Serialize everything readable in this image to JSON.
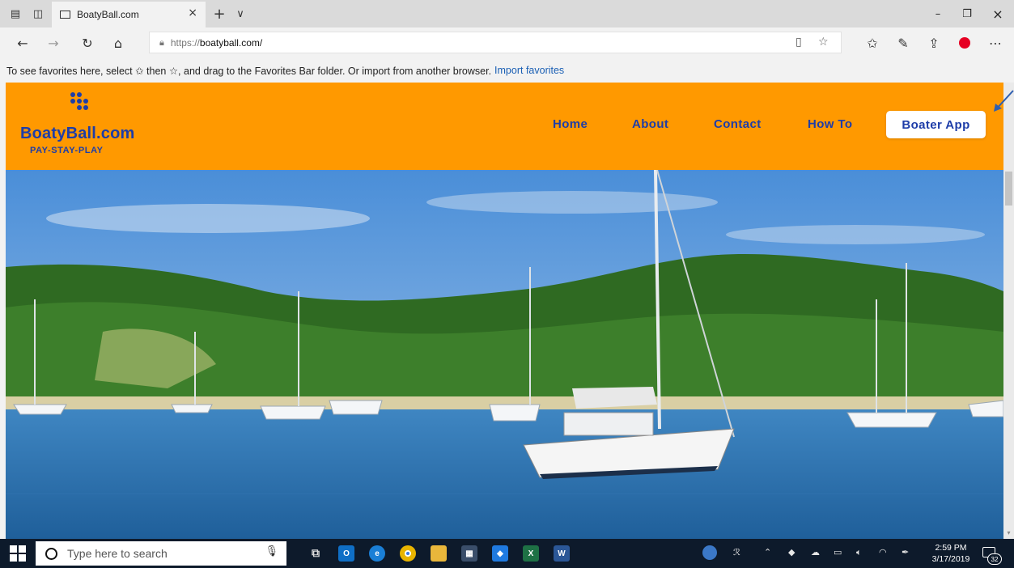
{
  "browser": {
    "tab": {
      "title": "BoatyBall.com",
      "close": "×"
    },
    "new_tab": "+",
    "tab_list": "∨",
    "window_controls": {
      "minimize": "–",
      "restore": "❐",
      "close": "×"
    },
    "address": {
      "scheme": "https://",
      "host": "boatyball.com/"
    },
    "favorites_bar": {
      "message": "To see favorites here, select ✩ then ☆, and drag to the Favorites Bar folder. Or import from another browser.",
      "link": "Import favorites"
    },
    "icons": [
      "tab-aside-icon",
      "tab-preview-icon",
      "back-icon",
      "forward-icon",
      "refresh-icon",
      "home-icon",
      "reading-view-icon",
      "favorite-star-icon",
      "favorites-hub-icon",
      "pen-icon",
      "share-icon",
      "pinterest-icon",
      "more-icon"
    ]
  },
  "site": {
    "brand": {
      "name": "BoatyBall.com",
      "tagline": "PAY-STAY-PLAY"
    },
    "nav": [
      "Home",
      "About",
      "Contact",
      "How To"
    ],
    "cta": "Boater App",
    "colors": {
      "header": "#ff9900",
      "brand_blue": "#1e3da8"
    }
  },
  "taskbar": {
    "search_placeholder": "Type here to search",
    "apps": [
      "task-view",
      "outlook",
      "edge",
      "chrome",
      "file-explorer",
      "store",
      "dropbox",
      "excel",
      "word"
    ],
    "clock": {
      "time": "2:59 PM",
      "date": "3/17/2019"
    },
    "notifications": "32"
  }
}
